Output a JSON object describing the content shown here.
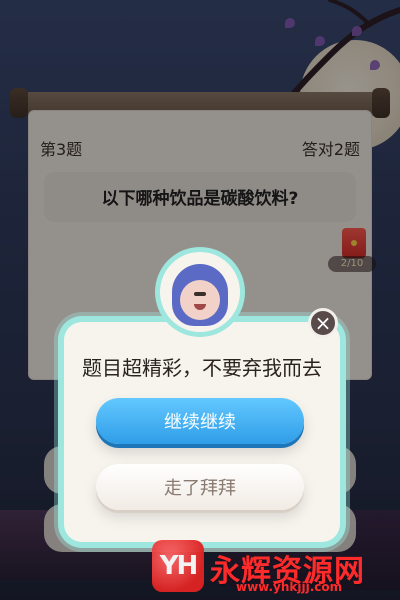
{
  "quiz": {
    "question_number": "第3题",
    "correct_count": "答对2题",
    "question": "以下哪种饮品是碳酸饮料?"
  },
  "reward": {
    "progress": "2/10"
  },
  "modal": {
    "message": "题目超精彩，不要弃我而去",
    "continue_label": "继续继续",
    "leave_label": "走了拜拜",
    "close_icon": "close-icon",
    "avatar_icon": "crying-avatar-icon"
  },
  "watermark": {
    "logo_text": "YH",
    "title": "永辉资源网",
    "url": "www.yhkjjj.com"
  },
  "colors": {
    "modal_border": "#9ee7df",
    "primary_button": "#2f9de8",
    "watermark_red": "#ff2b2b"
  }
}
